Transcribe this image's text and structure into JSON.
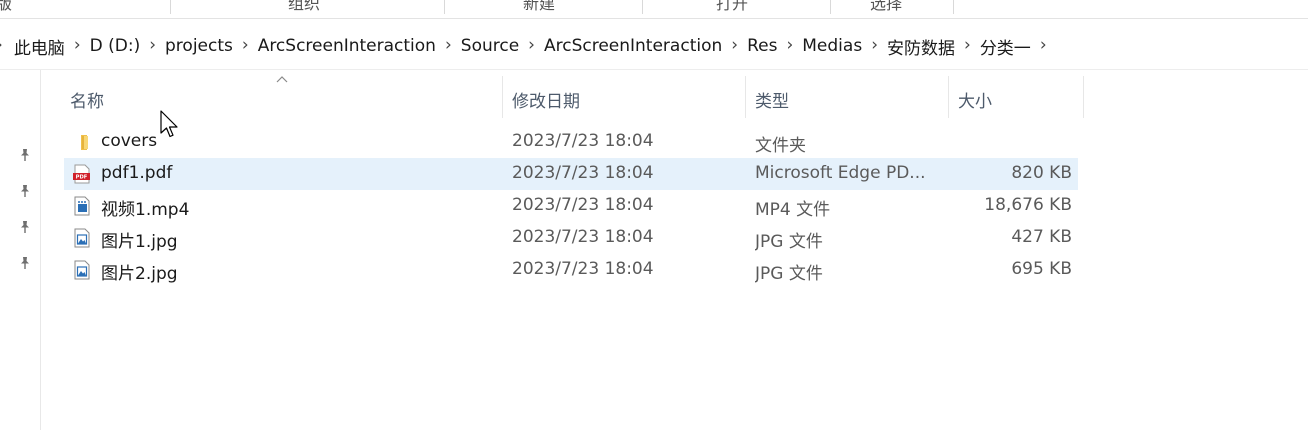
{
  "ribbon": {
    "groups": [
      "版",
      "组织",
      "新建",
      "打开",
      "选择"
    ]
  },
  "address": {
    "crumbs": [
      "此电脑",
      "D (D:)",
      "projects",
      "ArcScreenInteraction",
      "Source",
      "ArcScreenInteraction",
      "Res",
      "Medias",
      "安防数据",
      "分类一"
    ]
  },
  "columns": {
    "name": "名称",
    "date": "修改日期",
    "type": "类型",
    "size": "大小"
  },
  "files": [
    {
      "name": "covers",
      "date": "2023/7/23 18:04",
      "type": "文件夹",
      "size": "",
      "icon": "folder-icon"
    },
    {
      "name": "pdf1.pdf",
      "date": "2023/7/23 18:04",
      "type": "Microsoft Edge PD...",
      "size": "820 KB",
      "icon": "pdf-icon",
      "selected": true
    },
    {
      "name": "视频1.mp4",
      "date": "2023/7/23 18:04",
      "type": "MP4 文件",
      "size": "18,676 KB",
      "icon": "video-file-icon"
    },
    {
      "name": "图片1.jpg",
      "date": "2023/7/23 18:04",
      "type": "JPG 文件",
      "size": "427 KB",
      "icon": "image-file-icon"
    },
    {
      "name": "图片2.jpg",
      "date": "2023/7/23 18:04",
      "type": "JPG 文件",
      "size": "695 KB",
      "icon": "image-file-icon"
    }
  ],
  "colors": {
    "selection": "#e5f1fb",
    "folder": "#f8d775",
    "pdf": "#d0202a",
    "header_text": "#4d5a6b"
  }
}
